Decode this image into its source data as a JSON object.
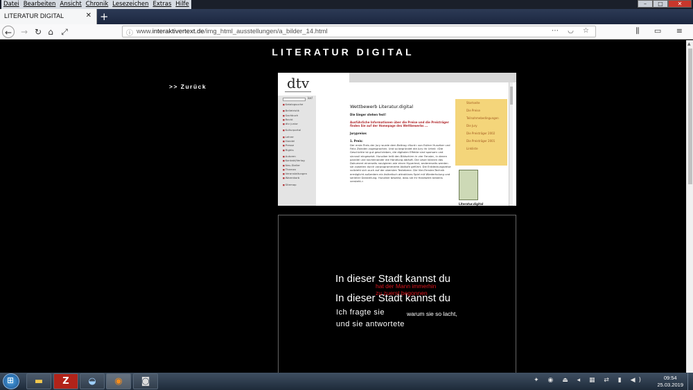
{
  "menubar": {
    "items": [
      "Datei",
      "Bearbeiten",
      "Ansicht",
      "Chronik",
      "Lesezeichen",
      "Extras",
      "Hilfe"
    ]
  },
  "window_controls": {
    "minimize": "–",
    "maximize": "□",
    "close": "✕"
  },
  "tab": {
    "title": "LITERATUR DIGITAL",
    "close": "✕"
  },
  "navbar": {
    "back": "←",
    "forward": "→",
    "reload": "↻",
    "home": "⌂",
    "fullscreen": "⤢",
    "url_prefix": "www.",
    "url_domain": "interaktivertext.de",
    "url_path": "/img_html_ausstellungen/a_bilder_14.html",
    "url_icons": "⋯ ◡ ☆",
    "right_icons": "⫼ ▭ ≡"
  },
  "page": {
    "title": "LITERATUR DIGITAL",
    "back_link": ">> Zurück"
  },
  "embedded_screenshot": {
    "logo": "dtv",
    "search_label": "los!",
    "nav_groups": [
      [
        "Katalogsuche"
      ],
      [
        "Belletristik",
        "Sachbuch",
        "Recht",
        "dtv junior"
      ],
      [
        "Kulturportal"
      ],
      [
        "Lehrer",
        "Handel",
        "Presse",
        "Rights"
      ],
      [
        "Autoren",
        "Kontakt/Verlag",
        "Neu-Steller",
        "Themen",
        "Veranstaltungen",
        "Warenkorb"
      ],
      [
        "Sitemap"
      ]
    ],
    "heading": "Wettbewerb Literatur.digital",
    "subheading": "Die Sieger stehen fest!",
    "info_link": "Ausführliche Informationen über die Preise und die Preisträger finden Sie auf der Homepage des Wettbewerbs ...",
    "jury_label": "Jurypreise:",
    "prize_label": "1. Preis:",
    "prize_text": "Der erste Preis der Jury wurde dem Beitrag »Nurd« von Esther Hunziker und Felix Zbinden zugesprochen. Und so begründet die Jury ihr Urteil: »Die Geschichte ist gut geschrieben, die digitalen Effekte sind sparsam und sinnvoll eingesetzt. Hunziker teilt den Bildschirm in vier Fenster, in denen parallel und nacheinander die Handlung abläuft. Die Leser können das Dokument einerseits navigieren wie einen Hypertext, andererseits werden sie zuweilen durch vorprogrammierte Abläufe geführt. Die Entdeckungsreise vollzieht sich auch auf der obersten Textebene. Die Vier-Fenster-Technik ermöglicht außerdem ein ästhetisch attraktives Spiel mit Wiederholung und serieller Darstellung. Hunziker beweist, dass sie ihr Handwerk bestens versteht.«",
    "right_menu": [
      "Startseite",
      "Die Preise",
      "Teilnahmebedingungen",
      "Die Jury",
      "Die Preisträger 2002",
      "Die Preisträger 2001",
      "Linkliste"
    ],
    "book_caption": "Literatur.digital"
  },
  "animation": {
    "line1": "In dieser Stadt kannst du",
    "red1": "hat der Mann immerhin",
    "red2": "zu zuerst begonnen",
    "line2": "In dieser Stadt kannst du",
    "line3": "Ich  fragte  sie",
    "line3b": "warum sie so lacht,",
    "line4": "und  sie  antwortete"
  },
  "taskbar": {
    "tray_icons": "✦ ◉ ⏏ ◂ ▦ ⇄ ▮ ◀)",
    "time": "09:54",
    "date": "25.03.2019"
  },
  "colors": {
    "page_bg": "#000000",
    "accent_red": "#d8141b",
    "menu_yellow": "#f4d57a"
  }
}
